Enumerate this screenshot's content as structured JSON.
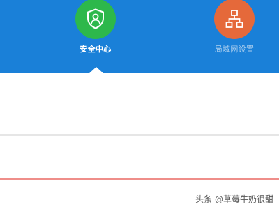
{
  "nav": {
    "items": [
      {
        "label": "安全中心",
        "icon": "shield-user-icon",
        "color": "#2db84b",
        "active": true
      },
      {
        "label": "局域网设置",
        "icon": "network-topology-icon",
        "color": "#e5693a",
        "active": false
      }
    ]
  },
  "watermark": {
    "text": "头条 @草莓牛奶很甜"
  },
  "colors": {
    "header_bg": "#1a80d8",
    "divider": "#e6e6e6",
    "accent_line": "#ef8e8a"
  }
}
